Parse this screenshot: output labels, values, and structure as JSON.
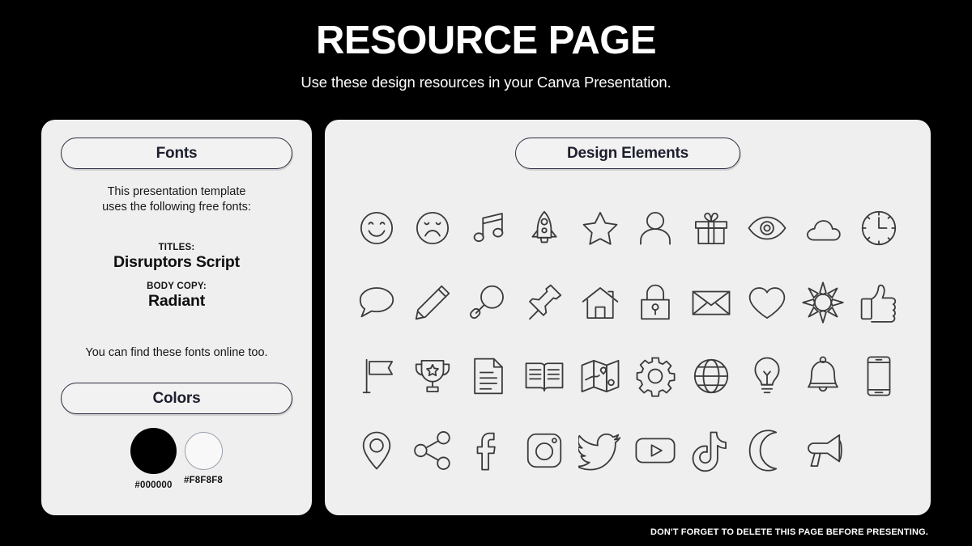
{
  "header": {
    "title": "RESOURCE PAGE",
    "subtitle": "Use these design resources in your Canva Presentation."
  },
  "fonts_card": {
    "heading": "Fonts",
    "intro_line1": "This presentation template",
    "intro_line2": "uses the following free fonts:",
    "titles_label": "TITLES:",
    "titles_font": "Disruptors Script",
    "body_label": "BODY COPY:",
    "body_font": "Radiant",
    "outro": "You can find these fonts online too."
  },
  "colors_card": {
    "heading": "Colors",
    "swatches": [
      {
        "hex": "#000000",
        "value": "#000000"
      },
      {
        "hex": "#F8F8F8",
        "value": "#F8F8F8"
      }
    ]
  },
  "design_card": {
    "heading": "Design Elements",
    "icons": [
      "smiley-face-icon",
      "sad-face-icon",
      "music-note-icon",
      "rocket-icon",
      "star-icon",
      "person-icon",
      "gift-icon",
      "eye-icon",
      "cloud-icon",
      "clock-icon",
      "speech-bubble-icon",
      "pencil-icon",
      "magnifying-glass-icon",
      "pushpin-icon",
      "house-icon",
      "lock-icon",
      "envelope-icon",
      "heart-icon",
      "sun-icon",
      "thumbs-up-icon",
      "flag-icon",
      "trophy-icon",
      "document-icon",
      "book-icon",
      "map-icon",
      "gear-icon",
      "globe-icon",
      "lightbulb-icon",
      "bell-icon",
      "phone-icon",
      "location-pin-icon",
      "share-icon",
      "facebook-icon",
      "instagram-icon",
      "twitter-icon",
      "youtube-icon",
      "tiktok-icon",
      "moon-icon",
      "megaphone-icon"
    ]
  },
  "footer": {
    "note": "DON'T FORGET TO DELETE THIS PAGE BEFORE PRESENTING."
  }
}
